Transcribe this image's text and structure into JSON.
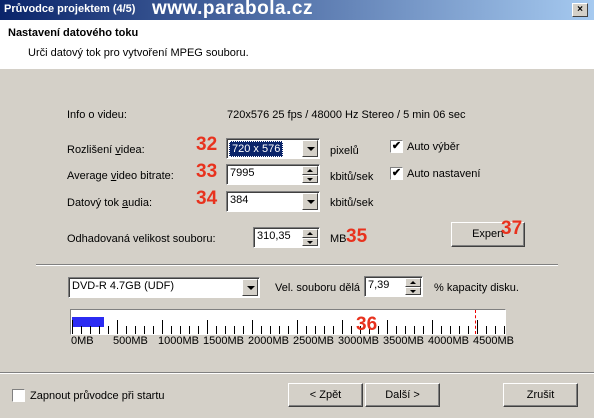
{
  "window": {
    "title": "Průvodce projektem (4/5)",
    "watermark": "www.parabola.cz",
    "close": "×"
  },
  "header": {
    "title": "Nastavení datového toku",
    "subtitle": "Urči datový tok pro vytvoření MPEG souboru."
  },
  "video_info": {
    "label": "Info o videu:",
    "value": "720x576 25 fps / 48000 Hz Stereo / 5 min 06 sec"
  },
  "resolution": {
    "label_pre": "Rozlišení ",
    "label_u": "v",
    "label_post": "idea:",
    "value": "720 x 576",
    "unit": "pixelů"
  },
  "avg_bitrate": {
    "label_pre": "Average ",
    "label_u": "v",
    "label_post": "ideo bitrate:",
    "value": "7995",
    "unit": "kbitů/sek"
  },
  "audio_bitrate": {
    "label_pre": "Datový tok ",
    "label_u": "a",
    "label_post": "udia:",
    "value": "384",
    "unit": "kbitů/sek"
  },
  "est_size": {
    "label": "Odhadovaná velikost souboru:",
    "value": "310,35",
    "unit": "MB"
  },
  "auto_select": {
    "label": "Auto výběr",
    "checked": "✔"
  },
  "auto_settings": {
    "label": "Auto nastavení",
    "checked": "✔"
  },
  "expert_button": "Expert",
  "annotations": {
    "n32": "32",
    "n33": "33",
    "n34": "34",
    "n35": "35",
    "n36": "36",
    "n37": "37"
  },
  "disc": {
    "selected": "DVD-R 4.7GB (UDF)",
    "size_label": "Vel. souboru dělá",
    "percent": "7,39",
    "percent_suffix": "% kapacity disku."
  },
  "ruler": {
    "fill_fraction": 0.0739,
    "limit_mb": 4480,
    "max_mb": 4800,
    "labels": [
      "0MB",
      "500MB",
      "1000MB",
      "1500MB",
      "2000MB",
      "2500MB",
      "3000MB",
      "3500MB",
      "4000MB",
      "4500MB"
    ]
  },
  "footer": {
    "startup_checkbox": "Zapnout průvodce při startu",
    "back_button": "< Zpět",
    "next_button": "Další >",
    "cancel_button": "Zrušit"
  },
  "colors": {
    "annotation_red": "#e8321e",
    "selection": "#0a246a",
    "ruler_fill": "#2b2bf2"
  }
}
